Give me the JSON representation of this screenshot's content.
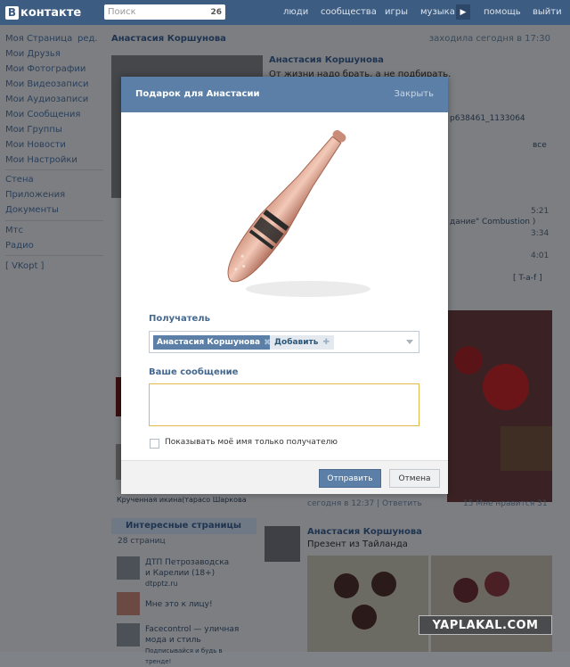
{
  "topbar": {
    "logo_text": "контакте",
    "logo_letter": "В",
    "search_placeholder": "Поиск",
    "notif_count": "26",
    "nav": [
      "люди",
      "сообщества",
      "игры",
      "музыка",
      "помощь",
      "выйти"
    ]
  },
  "sidebar": {
    "edit": "ред.",
    "items": [
      "Моя Страница",
      "Мои Друзья",
      "Мои Фотографии",
      "Мои Видеозаписи",
      "Мои Аудиозаписи",
      "Мои Сообщения",
      "Мои Группы",
      "Мои Новости",
      "Мои Настройки"
    ],
    "items2": [
      "Стена",
      "Приложения",
      "Документы"
    ],
    "items3": [
      "Мтс",
      "Радио"
    ],
    "vkopt": "[ VKopt ]"
  },
  "profile": {
    "name": "Анастасия Коршунова",
    "last_seen": "заходила сегодня в 17:30",
    "status_name": "Анастасия Коршунова",
    "status_text": "От жизни надо брать, а не подбирать.",
    "id_fragment": "p638461_1133064",
    "song": "дание\" Combustion )",
    "tag": "[ T-a-f ]",
    "all": "все",
    "times": [
      "5:21",
      "3:34",
      "4:01"
    ],
    "friends_strip": "Крученная  икина(тарасо  Шаркова",
    "interesting_header": "Интересные страницы",
    "interesting_count": "28 страниц",
    "pages": [
      {
        "title": "ДТП Петрозаводска и Карелии (18+)",
        "sub": "dtpptz.ru"
      },
      {
        "title": "Мне это к лицу!",
        "sub": ""
      },
      {
        "title": "Facecontrol — уличная мода и стиль",
        "sub": "Подписывайся и будь в тренде!"
      }
    ],
    "post_meta": "сегодня в 12:37  |  Ответить",
    "post_likes": "15   Мне нравится  31",
    "post2_name": "Анастасия Коршунова",
    "post2_text": "Презент из Тайланда"
  },
  "watermark": "YAPLAKAL.COM",
  "modal": {
    "title": "Подарок для Анастасии",
    "close": "Закрыть",
    "gift_icon": "baseball-bat-gift",
    "recipient_label": "Получатель",
    "recipient_token": "Анастасия Коршунова",
    "add_label": "Добавить",
    "message_label": "Ваше сообщение",
    "message_value": "",
    "private_label": "Показывать моё имя только получателю",
    "private_checked": false,
    "send_label": "Отправить",
    "cancel_label": "Отмена"
  },
  "colors": {
    "accent": "#5b7fa6",
    "topbar": "#3d5c81",
    "focus_border": "#e0b94a"
  }
}
